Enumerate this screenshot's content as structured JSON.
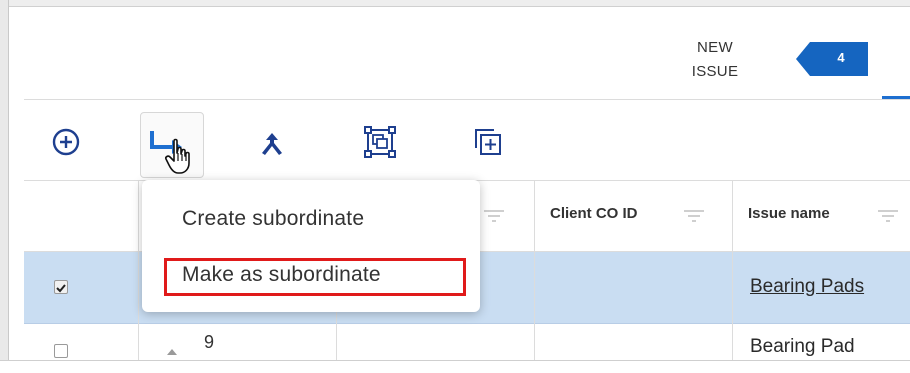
{
  "tab": {
    "line1": "NEW",
    "line2": "ISSUE",
    "count": "4"
  },
  "toolbar": {
    "add_icon": "plus-circle-icon",
    "subordinate_icon": "subordinate-arrow-icon",
    "merge_icon": "merge-icon",
    "group_icon": "group-frame-icon",
    "duplicate_icon": "duplicate-plus-icon"
  },
  "table": {
    "headers": [
      "Client CO ID",
      "Issue name"
    ],
    "rows": [
      {
        "selected": true,
        "issue_name": "Bearing Pads"
      },
      {
        "selected": false,
        "number": "9",
        "issue_name": "Bearing Pad"
      }
    ]
  },
  "menu": {
    "items": [
      "Create subordinate",
      "Make as subordinate"
    ],
    "highlighted": "Make as subordinate"
  },
  "colors": {
    "accent": "#1e6fd0",
    "highlight": "#e01a1a",
    "selected_row": "#c9ddf2"
  }
}
